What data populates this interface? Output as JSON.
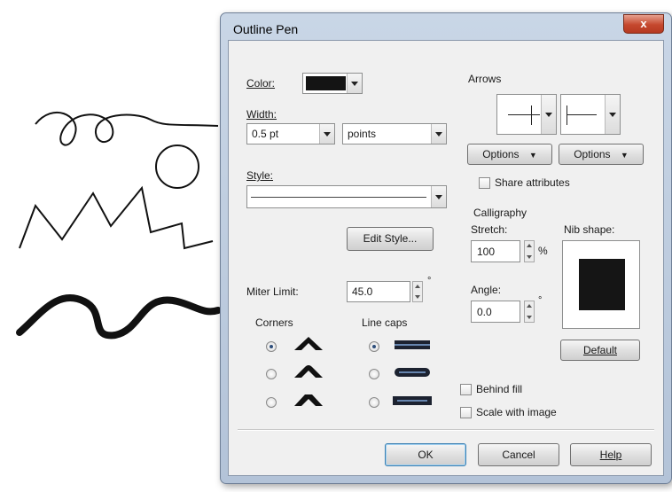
{
  "dialog": {
    "title": "Outline Pen",
    "close_label": "x"
  },
  "color": {
    "label": "Color:",
    "swatch": "#141414"
  },
  "width": {
    "label": "Width:",
    "value": "0.5 pt",
    "units": "points"
  },
  "style": {
    "label": "Style:"
  },
  "edit_style_label": "Edit Style...",
  "miter": {
    "label": "Miter Limit:",
    "value": "45.0",
    "unit": "°"
  },
  "corners": {
    "label": "Corners",
    "selected": 0
  },
  "line_caps": {
    "label": "Line caps",
    "selected": 0
  },
  "arrows": {
    "label": "Arrows",
    "start_options_label": "Options",
    "end_options_label": "Options",
    "share_label": "Share attributes",
    "share_checked": false
  },
  "calligraphy": {
    "label": "Calligraphy",
    "stretch_label": "Stretch:",
    "stretch_value": "100",
    "stretch_unit": "%",
    "angle_label": "Angle:",
    "angle_value": "0.0",
    "angle_unit": "°",
    "nib_label": "Nib shape:",
    "default_label": "Default"
  },
  "options": {
    "behind_fill_label": "Behind fill",
    "behind_fill_checked": false,
    "scale_label": "Scale with image",
    "scale_checked": false
  },
  "buttons": {
    "ok": "OK",
    "cancel": "Cancel",
    "help": "Help"
  },
  "colors": {
    "accent": "#3c7fb1",
    "nib": "#151515"
  }
}
